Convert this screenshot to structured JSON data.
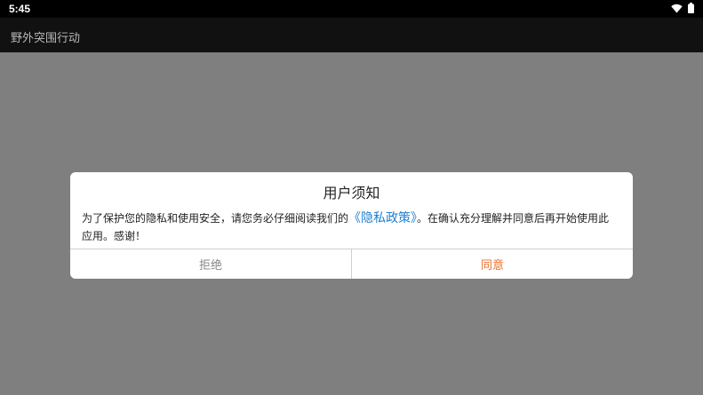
{
  "status_bar": {
    "time": "5:45",
    "icons": [
      "wifi-icon",
      "battery-icon"
    ]
  },
  "app_bar": {
    "title": "野外突围行动"
  },
  "dialog": {
    "title": "用户须知",
    "message_before": "为了保护您的隐私和使用安全，请您务必仔细阅读我们的",
    "policy_link": "《隐私政策》",
    "message_after": "。在确认充分理解并同意后再开始使用此应用。感谢！",
    "reject_label": "拒绝",
    "agree_label": "同意"
  },
  "colors": {
    "link": "#1f7fce",
    "agree": "#e8702a",
    "reject": "#888888",
    "overlay": "#7f7f7f"
  }
}
